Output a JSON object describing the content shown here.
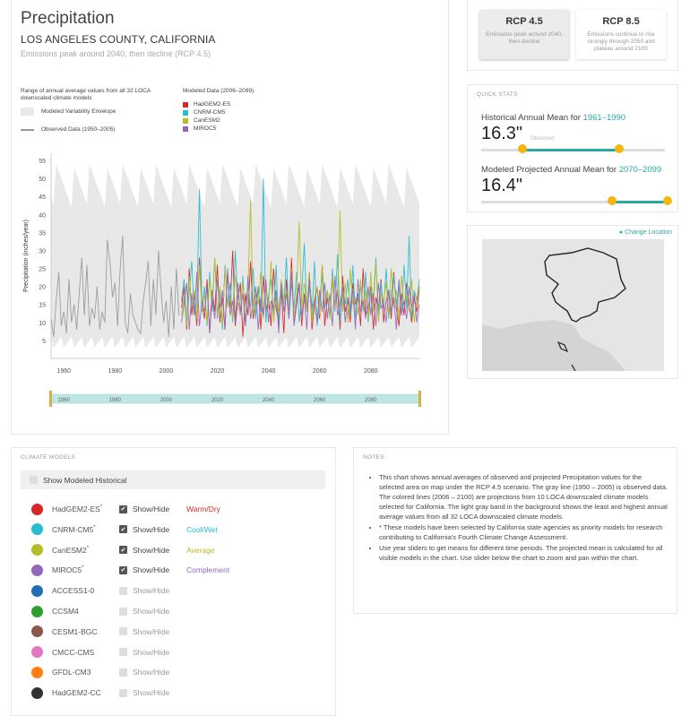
{
  "main": {
    "title": "Precipitation",
    "county": "LOS ANGELES COUNTY, CALIFORNIA",
    "scenario_desc": "Emissions peak around 2040, then decline (RCP 4.5)",
    "legend": {
      "range_text": "Range of annual average values from all 32 LOCA downscaled climate models",
      "envelope": "Modeled Variability Envelope",
      "observed": "Observed Data (1950–2005)",
      "modeled_title": "Modeled Data (2006–2099)",
      "models": [
        {
          "name": "HadGEM2-ES",
          "color": "#d62728"
        },
        {
          "name": "CNRM-CM5",
          "color": "#27bcd0"
        },
        {
          "name": "CanESM2",
          "color": "#b5bd23"
        },
        {
          "name": "MIROC5",
          "color": "#9467bd"
        }
      ]
    }
  },
  "chart_data": {
    "type": "line",
    "xlabel": "",
    "ylabel": "Precipitation (inches/year)",
    "xlim": [
      1950,
      2099
    ],
    "ylim": [
      0,
      57
    ],
    "yticks": [
      5,
      10,
      15,
      20,
      25,
      30,
      35,
      40,
      45,
      50,
      55
    ],
    "xticks": [
      1960,
      1980,
      2000,
      2020,
      2040,
      2060,
      2080
    ],
    "envelope": {
      "x_start": 1950,
      "x_end": 2099,
      "low_approx": 3,
      "high_approx": 50
    },
    "series": [
      {
        "name": "Observed Data (1950–2005)",
        "color": "#999999",
        "x_start": 1950,
        "values": [
          12,
          20,
          8,
          14,
          27,
          11,
          6,
          16,
          24,
          9,
          13,
          7,
          22,
          10,
          15,
          8,
          18,
          28,
          12,
          26,
          9,
          14,
          11,
          20,
          8,
          13,
          10,
          33,
          27,
          17,
          21,
          9,
          25,
          34,
          10,
          7,
          18,
          12,
          10,
          8,
          7,
          16,
          21,
          27,
          9,
          22,
          12,
          30,
          19,
          10,
          16,
          6,
          20,
          8,
          25,
          12
        ]
      },
      {
        "name": "HadGEM2-ES",
        "color": "#d62728",
        "x_start": 2006,
        "values": [
          14,
          20,
          8,
          25,
          12,
          18,
          9,
          28,
          15,
          11,
          22,
          7,
          19,
          13,
          26,
          10,
          17,
          8,
          24,
          14,
          30,
          9,
          16,
          21,
          6,
          18,
          12,
          27,
          11,
          15,
          20,
          8,
          23,
          13,
          17,
          9,
          25,
          14,
          10,
          19,
          7,
          22,
          12,
          28,
          10,
          16,
          21,
          9,
          18,
          13,
          24,
          8,
          15,
          20,
          11,
          26,
          9,
          17,
          12,
          22,
          14,
          19,
          8,
          23,
          13,
          16,
          10,
          21,
          15,
          18,
          9,
          25,
          12,
          14,
          20,
          8,
          17,
          13,
          22,
          10,
          16,
          19,
          11,
          24,
          14,
          9,
          18,
          12,
          21,
          15,
          10,
          17,
          13,
          20
        ]
      },
      {
        "name": "CNRM-CM5",
        "color": "#27bcd0",
        "x_start": 2006,
        "values": [
          16,
          22,
          10,
          18,
          27,
          12,
          15,
          47,
          14,
          20,
          9,
          24,
          13,
          28,
          11,
          19,
          8,
          26,
          15,
          21,
          10,
          30,
          16,
          12,
          23,
          9,
          18,
          14,
          25,
          11,
          20,
          13,
          50,
          10,
          17,
          22,
          12,
          26,
          9,
          19,
          15,
          28,
          11,
          21,
          14,
          24,
          10,
          18,
          32,
          13,
          20,
          12,
          27,
          9,
          16,
          23,
          14,
          19,
          11,
          25,
          13,
          29,
          10,
          18,
          15,
          22,
          12,
          26,
          11,
          17,
          20,
          13,
          24,
          10,
          19,
          16,
          28,
          12,
          21,
          14,
          25,
          11,
          18,
          23,
          15,
          20,
          12,
          26,
          14,
          34,
          11,
          19,
          16,
          22
        ]
      },
      {
        "name": "CanESM2",
        "color": "#b5bd23",
        "x_start": 2006,
        "values": [
          12,
          17,
          9,
          23,
          14,
          19,
          11,
          26,
          13,
          18,
          10,
          22,
          15,
          28,
          12,
          20,
          9,
          25,
          14,
          17,
          11,
          23,
          16,
          13,
          21,
          10,
          19,
          44,
          12,
          18,
          15,
          24,
          11,
          20,
          14,
          27,
          10,
          17,
          13,
          22,
          16,
          19,
          12,
          25,
          11,
          18,
          38,
          14,
          21,
          13,
          24,
          10,
          17,
          20,
          12,
          26,
          15,
          19,
          11,
          23,
          14,
          18,
          41,
          13,
          21,
          10,
          25,
          15,
          17,
          12,
          22,
          14,
          19,
          11,
          24,
          13,
          27,
          10,
          18,
          16,
          21,
          12,
          25,
          14,
          19,
          11,
          23,
          15,
          18,
          13,
          22,
          10,
          17,
          20
        ]
      },
      {
        "name": "MIROC5",
        "color": "#9467bd",
        "x_start": 2006,
        "values": [
          10,
          15,
          21,
          8,
          18,
          12,
          24,
          9,
          16,
          13,
          20,
          7,
          17,
          11,
          22,
          14,
          19,
          8,
          25,
          12,
          16,
          10,
          21,
          13,
          18,
          9,
          23,
          11,
          15,
          20,
          8,
          17,
          12,
          22,
          10,
          16,
          14,
          19,
          7,
          21,
          13,
          18,
          11,
          24,
          9,
          15,
          20,
          12,
          17,
          8,
          22,
          14,
          16,
          10,
          19,
          13,
          21,
          11,
          18,
          9,
          23,
          12,
          15,
          20,
          10,
          17,
          14,
          19,
          8,
          22,
          13,
          16,
          11,
          20,
          12,
          18,
          9,
          21,
          14,
          15,
          10,
          19,
          13,
          17,
          8,
          22,
          12,
          16,
          11,
          20,
          14,
          18,
          10,
          15
        ]
      }
    ]
  },
  "rcp": {
    "rcp45": {
      "label": "RCP 4.5",
      "desc": "Emissions peak around 2040, then decline"
    },
    "rcp85": {
      "label": "RCP 8.5",
      "desc": "Emissions continue to rise strongly through 2050 and plateau around 2100"
    }
  },
  "stats": {
    "section_title": "QUICK STATS",
    "historical_label": "Historical Annual Mean for ",
    "historical_years": "1961–1990",
    "historical_value": "16.3\"",
    "historical_sub": "Observed",
    "projected_label": "Modeled Projected Annual Mean for ",
    "projected_years": "2070–2099",
    "projected_value": "16.4\""
  },
  "map": {
    "change_location": "Change Location"
  },
  "models": {
    "section_title": "CLIMATE MODELS",
    "show_modeled_historical": "Show Modeled Historical",
    "show_hide": "Show/Hide",
    "rows": [
      {
        "name": "HadGEM2-ES",
        "star": "*",
        "color": "#d62728",
        "checked": true,
        "tag": "Warm/Dry",
        "tag_color": "#d62728"
      },
      {
        "name": "CNRM-CM5",
        "star": "*",
        "color": "#27bcd0",
        "checked": true,
        "tag": "Cool/Wet",
        "tag_color": "#27bcd0"
      },
      {
        "name": "CanESM2",
        "star": "*",
        "color": "#b5bd23",
        "checked": true,
        "tag": "Average",
        "tag_color": "#b5bd23"
      },
      {
        "name": "MIROC5",
        "star": "*",
        "color": "#9467bd",
        "checked": true,
        "tag": "Complement",
        "tag_color": "#9467bd"
      },
      {
        "name": "ACCESS1-0",
        "star": "",
        "color": "#1f6fb4",
        "checked": false,
        "tag": "",
        "tag_color": ""
      },
      {
        "name": "CCSM4",
        "star": "",
        "color": "#2ca02c",
        "checked": false,
        "tag": "",
        "tag_color": ""
      },
      {
        "name": "CESM1-BGC",
        "star": "",
        "color": "#8c564b",
        "checked": false,
        "tag": "",
        "tag_color": ""
      },
      {
        "name": "CMCC-CMS",
        "star": "",
        "color": "#e377c2",
        "checked": false,
        "tag": "",
        "tag_color": ""
      },
      {
        "name": "GFDL-CM3",
        "star": "",
        "color": "#ff7f0e",
        "checked": false,
        "tag": "",
        "tag_color": ""
      },
      {
        "name": "HadGEM2-CC",
        "star": "",
        "color": "#333333",
        "checked": false,
        "tag": "",
        "tag_color": ""
      }
    ]
  },
  "notes": {
    "section_title": "NOTES",
    "items": [
      "This chart shows annual averages of observed and projected Precipitation values for the selected area on map under the RCP 4.5 scenario. The gray line (1950 – 2005) is observed data. The colored lines (2006 – 2100) are projections from 10 LOCA downscaled climate models selected for California. The light gray band in the background shows the least and highest annual average values from all 32 LOCA downscaled climate models.",
      "* These models have been selected by California state agencies as priority models for research contributing to California's Fourth Climate Change Assessment.",
      "Use year sliders to get means for different time periods. The projected mean is calculated for all visible models in the chart. Use slider below the chart to zoom and pan within the chart."
    ]
  }
}
